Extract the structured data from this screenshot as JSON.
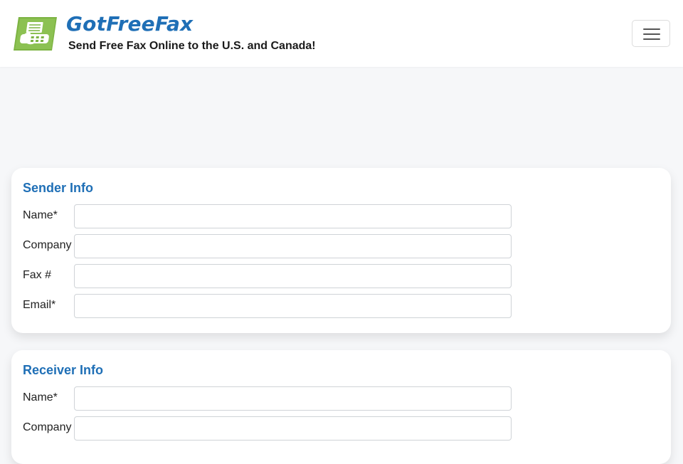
{
  "header": {
    "brand_name": "GotFreeFax",
    "tagline": "Send Free Fax Online to the U.S. and Canada!",
    "logo_icon": "fax-machine-icon",
    "menu_icon": "hamburger-menu-icon"
  },
  "colors": {
    "brand_blue": "#1f6fb6",
    "logo_green": "#7cb342",
    "page_background": "#f6f7f9"
  },
  "sender": {
    "title": "Sender Info",
    "fields": [
      {
        "label": "Name*",
        "value": "",
        "placeholder": ""
      },
      {
        "label": "Company",
        "value": "",
        "placeholder": ""
      },
      {
        "label": "Fax #",
        "value": "",
        "placeholder": ""
      },
      {
        "label": "Email*",
        "value": "",
        "placeholder": ""
      }
    ]
  },
  "receiver": {
    "title": "Receiver Info",
    "fields": [
      {
        "label": "Name*",
        "value": "",
        "placeholder": ""
      },
      {
        "label": "Company",
        "value": "",
        "placeholder": ""
      }
    ]
  }
}
